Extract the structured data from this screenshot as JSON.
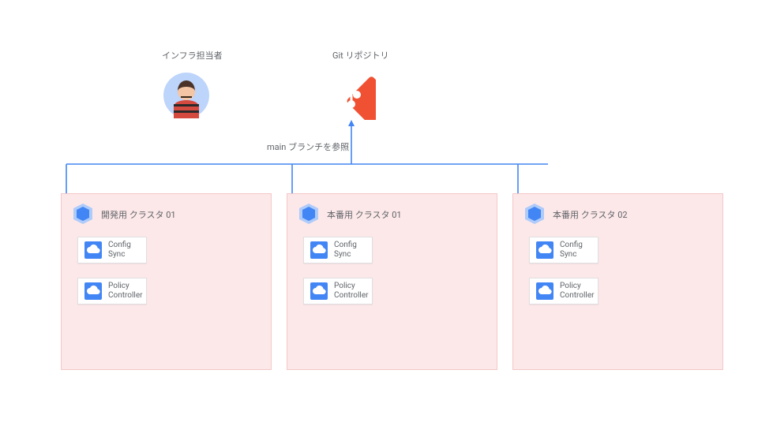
{
  "top": {
    "person_label": "インフラ担当者",
    "git_label": "Git リポジトリ",
    "branch_text": "main ブランチを参照"
  },
  "clusters": [
    {
      "title": "開発用 クラスタ 01",
      "components": {
        "sync": "Config\nSync",
        "policy": "Policy\nController"
      }
    },
    {
      "title": "本番用 クラスタ 01",
      "components": {
        "sync": "Config\nSync",
        "policy": "Policy\nController"
      }
    },
    {
      "title": "本番用 クラスタ 02",
      "components": {
        "sync": "Config\nSync",
        "policy": "Policy\nController"
      }
    }
  ],
  "colors": {
    "arrow": "#4285f4",
    "cluster_bg": "#fde8e9",
    "cluster_border": "#f4c7c8",
    "git": "#f05133"
  }
}
